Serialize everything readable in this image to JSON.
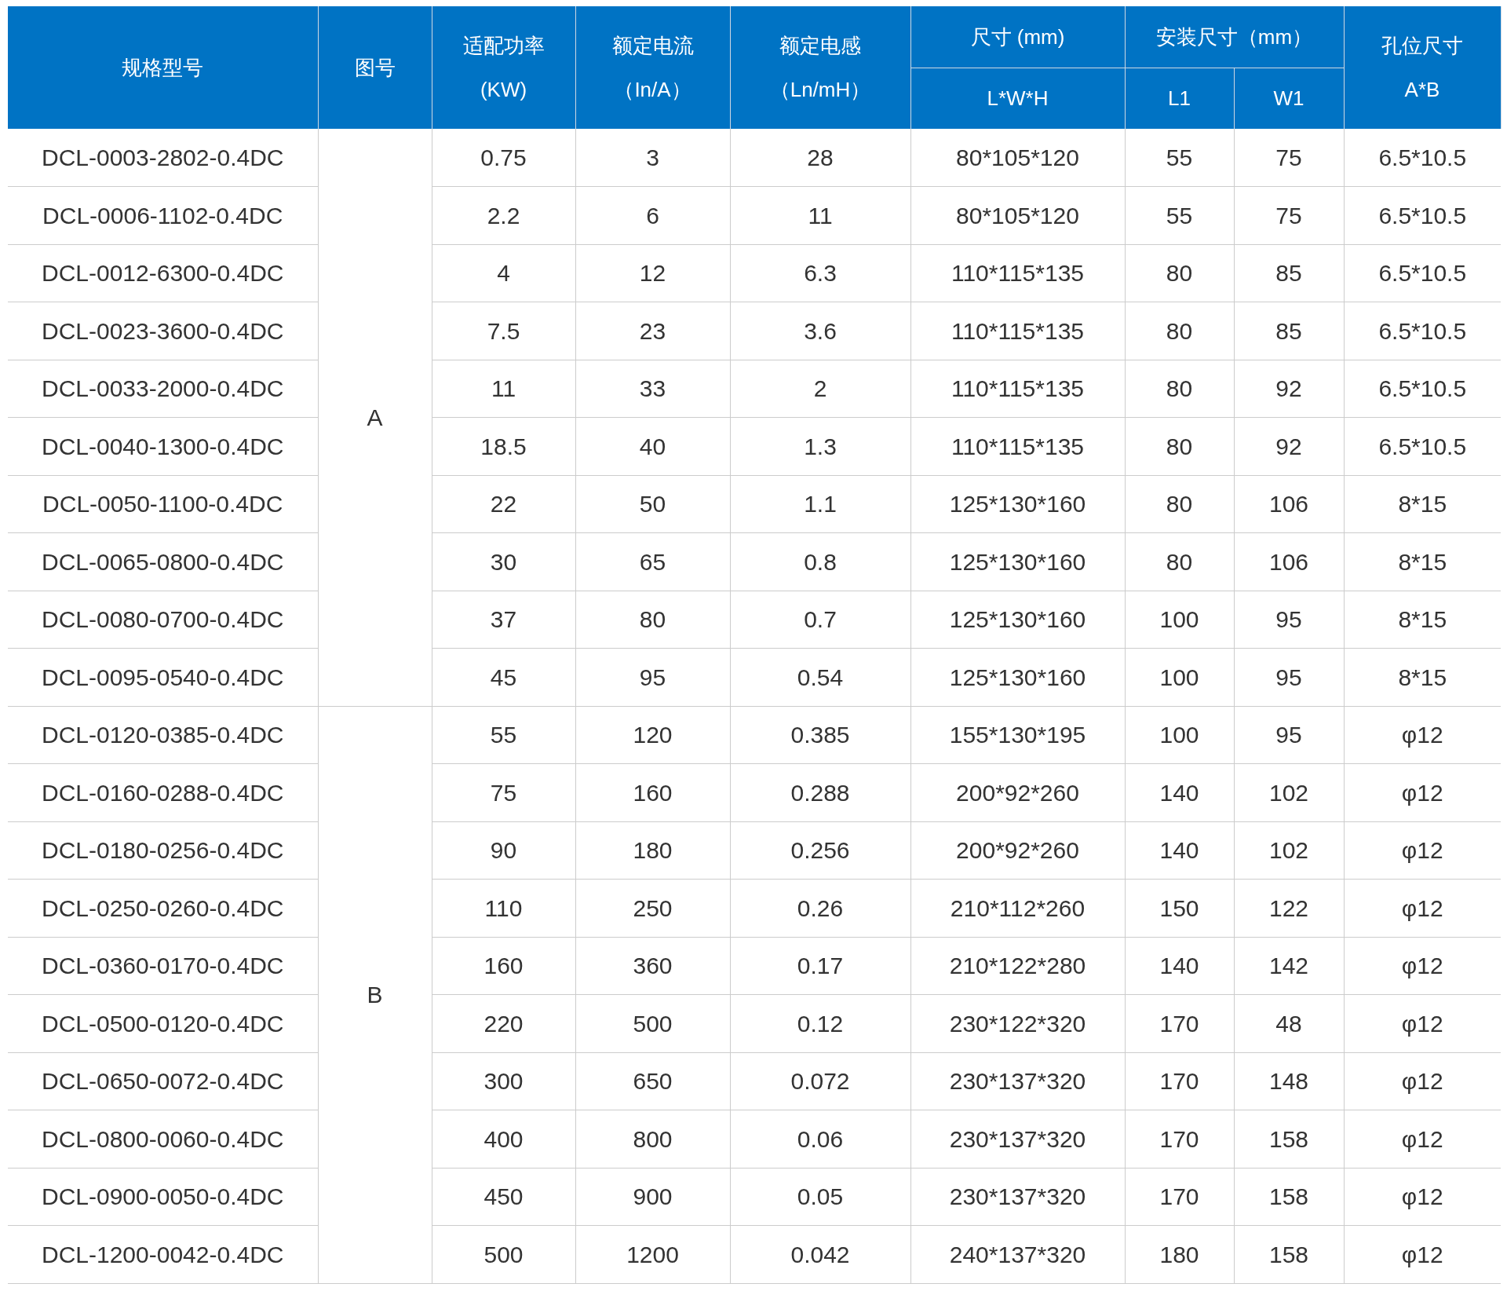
{
  "table": {
    "header_top": [
      [
        "规格型号"
      ],
      [
        "图号"
      ],
      [
        "适配功率",
        "(KW)"
      ],
      [
        "额定电流",
        "（In/A）"
      ],
      [
        "额定电感",
        "（Ln/mH）"
      ],
      [
        "尺寸 (mm)"
      ],
      [
        "安装尺寸（mm）"
      ],
      [
        "孔位尺寸",
        "A*B"
      ]
    ],
    "header_sub": [
      "L*W*H",
      "L1",
      "W1"
    ],
    "groups": [
      {
        "figure": "A",
        "rows": [
          [
            "DCL-0003-2802-0.4DC",
            "0.75",
            "3",
            "28",
            "80*105*120",
            "55",
            "75",
            "6.5*10.5"
          ],
          [
            "DCL-0006-1102-0.4DC",
            "2.2",
            "6",
            "11",
            "80*105*120",
            "55",
            "75",
            "6.5*10.5"
          ],
          [
            "DCL-0012-6300-0.4DC",
            "4",
            "12",
            "6.3",
            "110*115*135",
            "80",
            "85",
            "6.5*10.5"
          ],
          [
            "DCL-0023-3600-0.4DC",
            "7.5",
            "23",
            "3.6",
            "110*115*135",
            "80",
            "85",
            "6.5*10.5"
          ],
          [
            "DCL-0033-2000-0.4DC",
            "11",
            "33",
            "2",
            "110*115*135",
            "80",
            "92",
            "6.5*10.5"
          ],
          [
            "DCL-0040-1300-0.4DC",
            "18.5",
            "40",
            "1.3",
            "110*115*135",
            "80",
            "92",
            "6.5*10.5"
          ],
          [
            "DCL-0050-1100-0.4DC",
            "22",
            "50",
            "1.1",
            "125*130*160",
            "80",
            "106",
            "8*15"
          ],
          [
            "DCL-0065-0800-0.4DC",
            "30",
            "65",
            "0.8",
            "125*130*160",
            "80",
            "106",
            "8*15"
          ],
          [
            "DCL-0080-0700-0.4DC",
            "37",
            "80",
            "0.7",
            "125*130*160",
            "100",
            "95",
            "8*15"
          ],
          [
            "DCL-0095-0540-0.4DC",
            "45",
            "95",
            "0.54",
            "125*130*160",
            "100",
            "95",
            "8*15"
          ]
        ]
      },
      {
        "figure": "B",
        "rows": [
          [
            "DCL-0120-0385-0.4DC",
            "55",
            "120",
            "0.385",
            "155*130*195",
            "100",
            "95",
            "φ12"
          ],
          [
            "DCL-0160-0288-0.4DC",
            "75",
            "160",
            "0.288",
            "200*92*260",
            "140",
            "102",
            "φ12"
          ],
          [
            "DCL-0180-0256-0.4DC",
            "90",
            "180",
            "0.256",
            "200*92*260",
            "140",
            "102",
            "φ12"
          ],
          [
            "DCL-0250-0260-0.4DC",
            "110",
            "250",
            "0.26",
            "210*112*260",
            "150",
            "122",
            "φ12"
          ],
          [
            "DCL-0360-0170-0.4DC",
            "160",
            "360",
            "0.17",
            "210*122*280",
            "140",
            "142",
            "φ12"
          ],
          [
            "DCL-0500-0120-0.4DC",
            "220",
            "500",
            "0.12",
            "230*122*320",
            "170",
            "48",
            "φ12"
          ],
          [
            "DCL-0650-0072-0.4DC",
            "300",
            "650",
            "0.072",
            "230*137*320",
            "170",
            "148",
            "φ12"
          ],
          [
            "DCL-0800-0060-0.4DC",
            "400",
            "800",
            "0.06",
            "230*137*320",
            "170",
            "158",
            "φ12"
          ],
          [
            "DCL-0900-0050-0.4DC",
            "450",
            "900",
            "0.05",
            "230*137*320",
            "170",
            "158",
            "φ12"
          ],
          [
            "DCL-1200-0042-0.4DC",
            "500",
            "1200",
            "0.042",
            "240*137*320",
            "180",
            "158",
            "φ12"
          ]
        ]
      }
    ]
  }
}
